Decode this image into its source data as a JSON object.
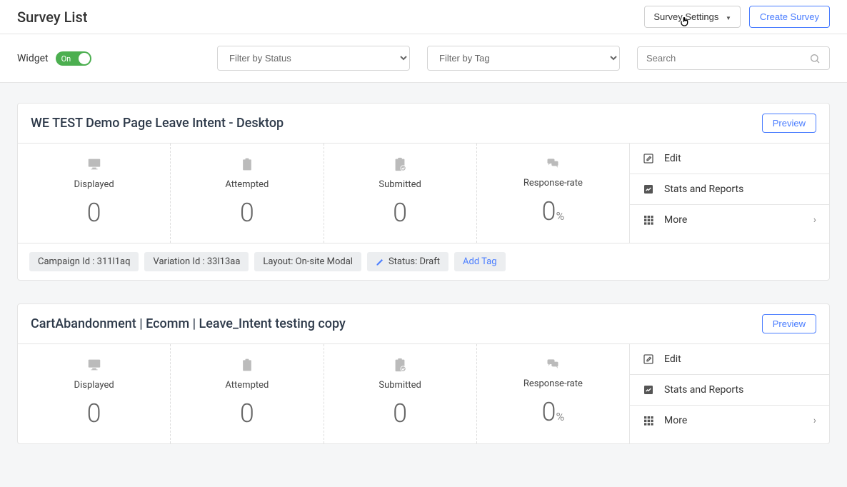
{
  "header": {
    "title": "Survey List",
    "settings_label": "Survey Settings",
    "create_label": "Create Survey"
  },
  "filters": {
    "widget_label": "Widget",
    "toggle_state": "On",
    "status_label": "Filter by Status",
    "tag_label": "Filter by Tag",
    "search_placeholder": "Search"
  },
  "stats_labels": {
    "displayed": "Displayed",
    "attempted": "Attempted",
    "submitted": "Submitted",
    "response_rate": "Response-rate"
  },
  "actions": {
    "edit": "Edit",
    "stats": "Stats and Reports",
    "more": "More"
  },
  "preview_label": "Preview",
  "add_tag_label": "Add Tag",
  "surveys": [
    {
      "title": "WE TEST Demo Page Leave Intent - Desktop",
      "displayed": "0",
      "attempted": "0",
      "submitted": "0",
      "response_rate": "0",
      "response_suffix": "%",
      "tags": {
        "campaign": "Campaign Id : 311l1aq",
        "variation": "Variation Id : 33l13aa",
        "layout": "Layout: On-site Modal",
        "status": "Status: Draft"
      }
    },
    {
      "title": "CartAbandonment | Ecomm | Leave_Intent testing copy",
      "displayed": "0",
      "attempted": "0",
      "submitted": "0",
      "response_rate": "0",
      "response_suffix": "%"
    }
  ]
}
